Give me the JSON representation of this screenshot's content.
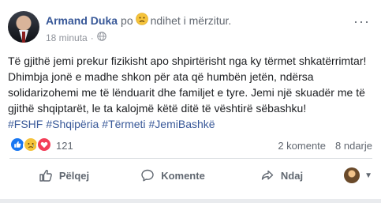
{
  "post": {
    "author": "Armand Duka",
    "verb": "po",
    "feeling_emoji": "sad-face-icon",
    "feeling": "ndihet i mërzitur.",
    "time": "18 minuta",
    "audience_icon": "globe-icon",
    "text": "Të gjithë jemi prekur fizikisht apo shpirtërisht nga ky tërmet shkatërrimtar! Dhimbja jonë e madhe shkon për ata që humbën jetën, ndërsa solidarizohemi me të lënduarit dhe familjet e tyre. Jemi një skuadër me të gjithë shqiptarët, le ta kalojmë këtë ditë të vështirë sëbashku!",
    "hashtags": [
      "#FSHF",
      "#Shqipëria",
      "#Tërmeti",
      "#JemiBashkë"
    ]
  },
  "reactions": {
    "icons": [
      "like-icon",
      "sad-icon",
      "love-icon"
    ],
    "count": "121",
    "comments": "2 komente",
    "shares": "8 ndarje"
  },
  "actions": {
    "like": "Pëlqej",
    "comment": "Komente",
    "share": "Ndaj"
  },
  "colors": {
    "link": "#385898",
    "muted": "#616770",
    "like_blue": "#1877f2",
    "sad_yellow": "#f5c33b",
    "love_red": "#f33e58"
  }
}
